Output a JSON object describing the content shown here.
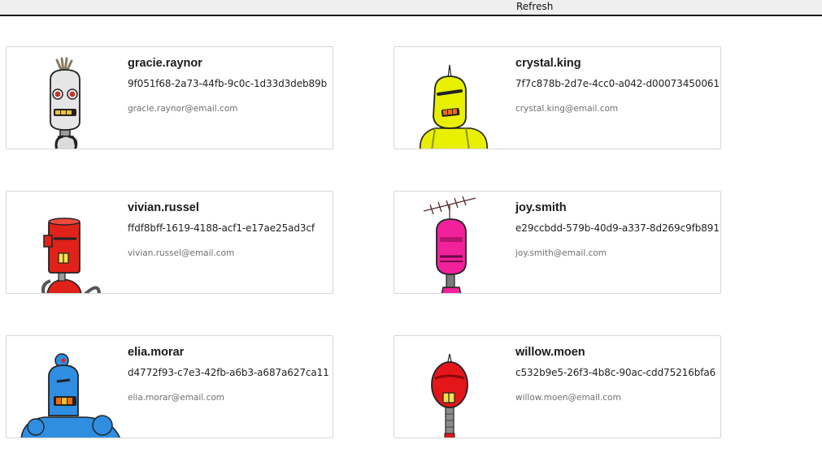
{
  "toolbar": {
    "refresh_label": "Refresh"
  },
  "users": [
    {
      "username": "gracie.raynor",
      "uuid": "9f051f68-2a73-44fb-9c0c-1d33d3deb89b",
      "email": "gracie.raynor@email.com",
      "robot_color": "#e6e6e6"
    },
    {
      "username": "crystal.king",
      "uuid": "7f7c878b-2d7e-4cc0-a042-d00073450061",
      "email": "crystal.king@email.com",
      "robot_color": "#e8f000"
    },
    {
      "username": "vivian.russel",
      "uuid": "ffdf8bff-1619-4188-acf1-e17ae25ad3cf",
      "email": "vivian.russel@email.com",
      "robot_color": "#e0221a"
    },
    {
      "username": "joy.smith",
      "uuid": "e29ccbdd-579b-40d9-a337-8d269c9fb891",
      "email": "joy.smith@email.com",
      "robot_color": "#f0219a"
    },
    {
      "username": "elia.morar",
      "uuid": "d4772f93-c7e3-42fb-a6b3-a687a627ca11",
      "email": "elia.morar@email.com",
      "robot_color": "#2f8ee0"
    },
    {
      "username": "willow.moen",
      "uuid": "c532b9e5-26f3-4b8c-90ac-cdd75216bfa6",
      "email": "willow.moen@email.com",
      "robot_color": "#e3161a"
    }
  ]
}
